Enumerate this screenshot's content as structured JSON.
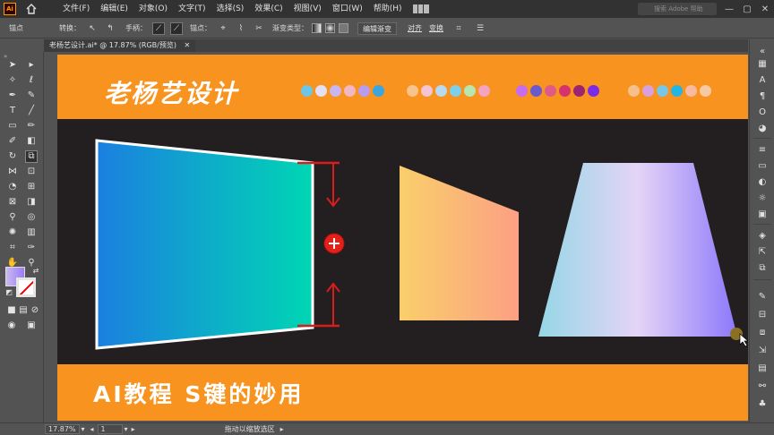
{
  "app": {
    "logo_text": "Ai"
  },
  "menu": [
    "文件(F)",
    "编辑(E)",
    "对象(O)",
    "文字(T)",
    "选择(S)",
    "效果(C)",
    "视图(V)",
    "窗口(W)",
    "帮助(H)"
  ],
  "search": {
    "placeholder": "搜索 Adobe 帮助"
  },
  "control_bar": {
    "anchor_label": "锚点",
    "convert_label": "转换：",
    "handles_label": "手柄：",
    "anchors_label": "锚点：",
    "gradient_type_label": "渐变类型：",
    "edit_gradient_button": "编辑渐变",
    "align_label": "对齐",
    "transform_label": "变换"
  },
  "document": {
    "tab_title": "老杨艺设计.ai* @ 17.87% (RGB/预览)"
  },
  "artboard": {
    "brand_title": "老杨艺设计",
    "tutorial_title": "AI教程  S键的妙用",
    "swatch_groups": [
      [
        "#6ec6e6",
        "#e2e0f2",
        "#c8b6f0",
        "#f1b8c4",
        "#b79cf0",
        "#3aa5e0"
      ],
      [
        "#f6c48c",
        "#f3c4d4",
        "#b8d9f0",
        "#7ed0e8",
        "#b7e6b0",
        "#f4a4c0"
      ],
      [
        "#c56cf0",
        "#6a5acd",
        "#e05a88",
        "#d6336c",
        "#9c2470",
        "#7d2ae8"
      ],
      [
        "#f5c08a",
        "#d9a0e0",
        "#78c7e8",
        "#25b5e5",
        "#f7b9a0",
        "#f6c9a2"
      ]
    ]
  },
  "status_bar": {
    "zoom": "17.87%",
    "page": "1",
    "status_text": "拖动以缩放选区"
  }
}
